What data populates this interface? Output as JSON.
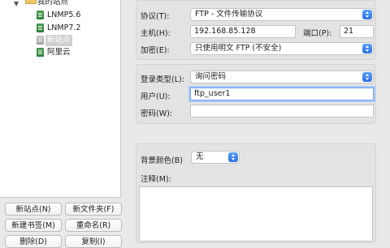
{
  "tree": {
    "root": "我的站点",
    "sites": [
      "LNMP5.6",
      "LNMP7.2",
      "新站点",
      "阿里云"
    ]
  },
  "buttons": {
    "new_site": "新站点(N)",
    "new_folder": "新文件夹(F)",
    "new_bookmark": "新建书签(M)",
    "rename": "重命名(R)",
    "delete": "删除(D)",
    "copy": "复制(I)"
  },
  "form": {
    "protocol_label": "协议(T):",
    "protocol_value": "FTP - 文件传输协议",
    "host_label": "主机(H):",
    "host_value": "192.168.85.128",
    "port_label": "端口(P):",
    "port_value": "21",
    "encryption_label": "加密(E):",
    "encryption_value": "只使用明文 FTP (不安全)",
    "logon_type_label": "登录类型(L):",
    "logon_type_value": "询问密码",
    "user_label": "用户(U):",
    "user_value": "ftp_user1",
    "password_label": "密码(W):",
    "password_value": "",
    "bg_color_label": "背景颜色(B)",
    "bg_color_value": "无",
    "comments_label": "注释(M):",
    "comments_value": ""
  }
}
